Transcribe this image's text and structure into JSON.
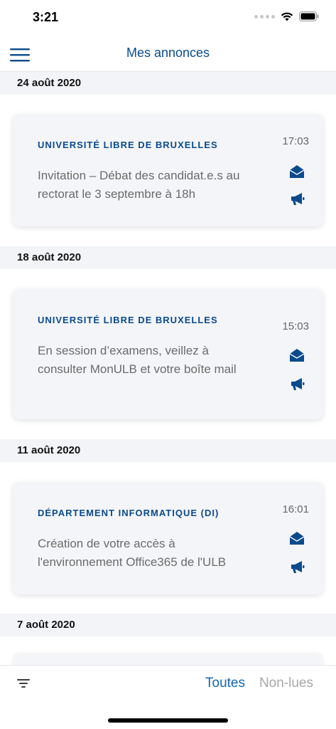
{
  "status_bar": {
    "time": "3:21"
  },
  "nav": {
    "title": "Mes annonces"
  },
  "colors": {
    "accent": "#0a4a8c",
    "tab_active": "#1566b0",
    "tab_inactive": "#a8a8a8",
    "section_bg": "#f2f4f7",
    "card_bg": "#f4f5f8"
  },
  "sections": [
    {
      "date": "24 août 2020",
      "card": {
        "sender": "UNIVERSITÉ LIBRE DE BRUXELLES",
        "time": "17:03",
        "body": "Invitation – Débat des candidat.e.s au rectorat le 3 septembre à 18h",
        "icons": [
          "envelope-open-icon",
          "megaphone-icon"
        ]
      }
    },
    {
      "date": "18 août 2020",
      "card": {
        "sender": "UNIVERSITÉ LIBRE DE BRUXELLES",
        "time": "15:03",
        "body": "En session d’examens, veillez à consulter MonULB et votre boîte mail",
        "icons": [
          "envelope-open-icon",
          "megaphone-icon"
        ]
      }
    },
    {
      "date": "11 août 2020",
      "card": {
        "sender": "DÉPARTEMENT INFORMATIQUE (DI)",
        "time": "16:01",
        "body": "Création de votre accès à l'environnement Office365 de l'ULB",
        "icons": [
          "envelope-open-icon",
          "megaphone-icon"
        ]
      }
    },
    {
      "date": "7 août 2020"
    }
  ],
  "bottom_bar": {
    "tab_all": "Toutes",
    "tab_unread": "Non-lues"
  }
}
